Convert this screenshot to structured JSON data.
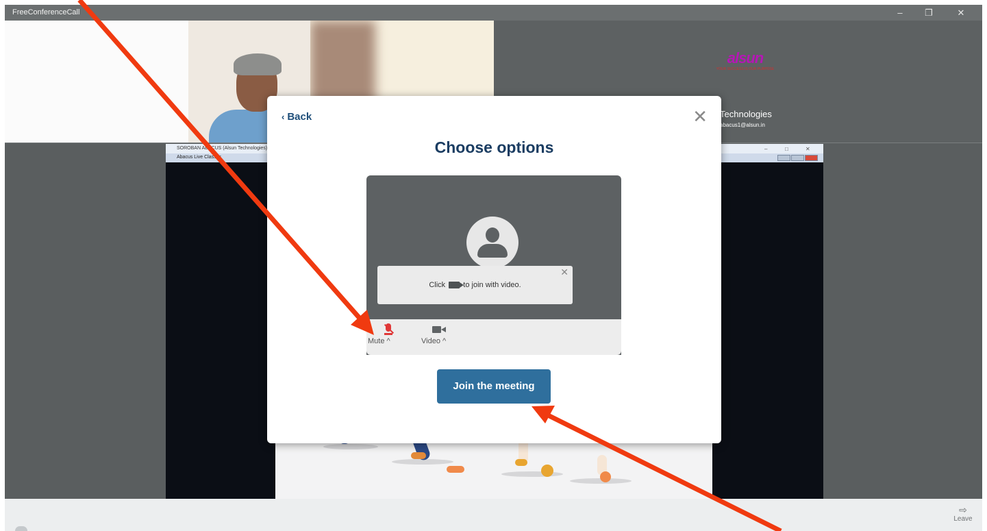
{
  "window": {
    "title": "FreeConferenceCall",
    "minimize": "–",
    "maximize": "❐",
    "close": "✕"
  },
  "participant": {
    "logo_text": "alsun",
    "logo_tagline": "YOUR SUCCESS IS OUR PURPOSE",
    "name": "Technologies",
    "email": "abacus1@alsun.in"
  },
  "shared_screen": {
    "window_title": "SOROBAN ABACUS (Alsun Technologies)",
    "tab_title": "Abacus Live Classes",
    "min": "–",
    "max": "□",
    "close": "✕"
  },
  "modal": {
    "back_label": "Back",
    "heading": "Choose options",
    "tip_before": "Click",
    "tip_after": "to join with video.",
    "tip_close": "✕",
    "mute_label": "Mute",
    "video_label": "Video",
    "caret": "^",
    "join_label": "Join the meeting",
    "close_symbol": "✕"
  },
  "bottom_bar": {
    "leave_label": "Leave"
  },
  "colors": {
    "accent": "#2f6f9d",
    "heading": "#1b3d62",
    "mute_red": "#e03838",
    "annotation_arrow": "#f03a10"
  }
}
